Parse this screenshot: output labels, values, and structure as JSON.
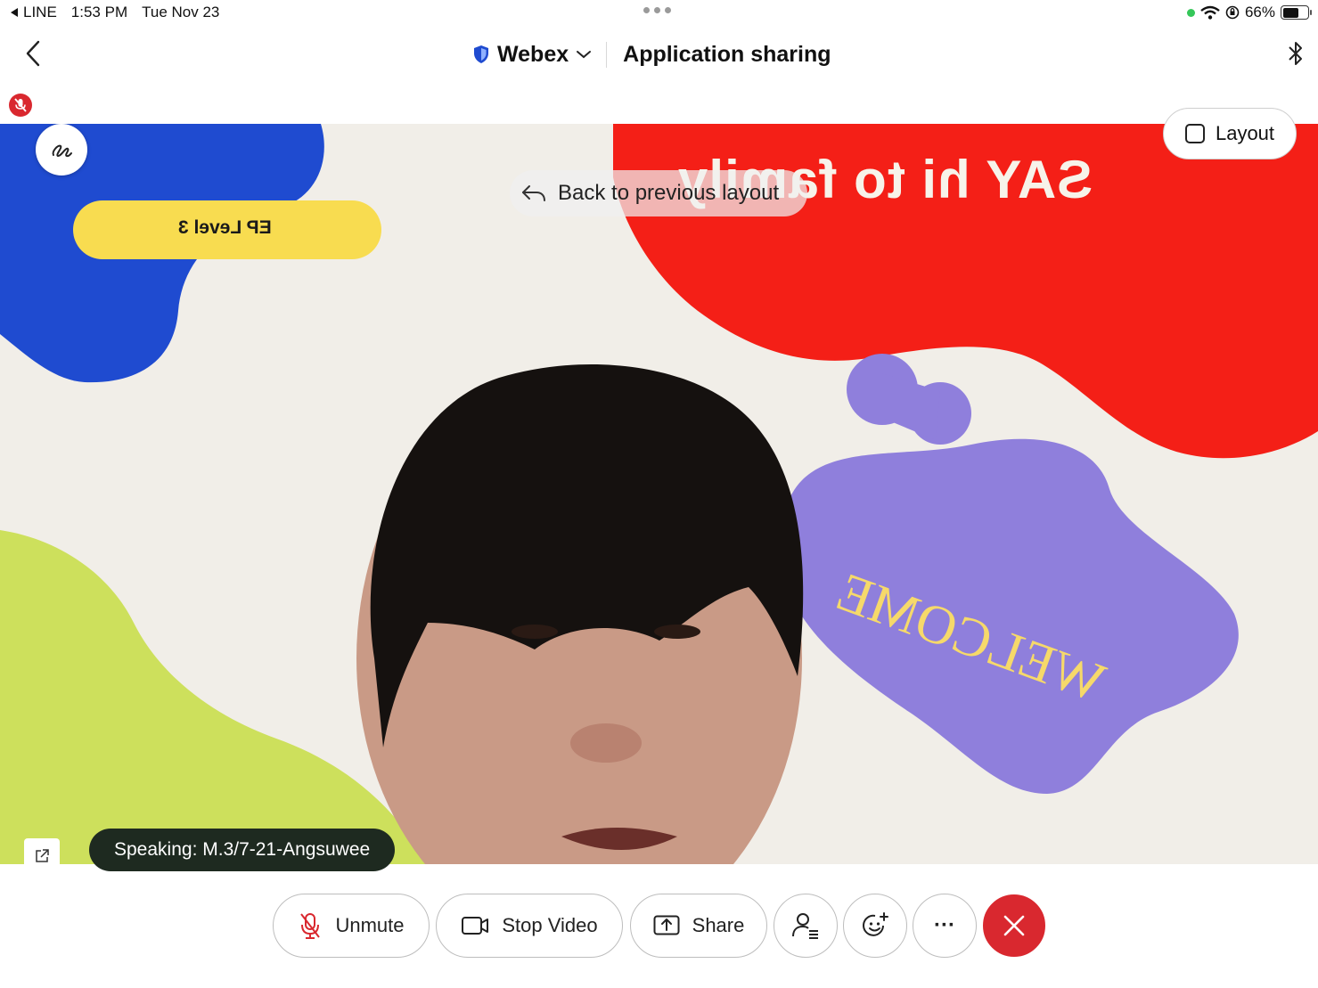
{
  "status_bar": {
    "back_app": "LINE",
    "time": "1:53 PM",
    "date": "Tue Nov 23",
    "battery": "66%"
  },
  "nav": {
    "app_name": "Webex",
    "title": "Application sharing"
  },
  "video": {
    "banner_text": "SAY hi to family",
    "level_text": "EP Level 3",
    "welcome_text": "WELCOME",
    "layout_label": "Layout",
    "back_layout_label": "Back to previous layout",
    "speaking": "Speaking: M.3/7-21-Angsuwee"
  },
  "controls": {
    "unmute_label": "Unmute",
    "stop_video_label": "Stop Video",
    "share_label": "Share",
    "more_label": "···"
  },
  "colors": {
    "end_call": "#d9282f",
    "accent_blue": "#1f4bd0",
    "banner_red": "#f41f17",
    "level_yellow": "#f8dc50",
    "welcome_purple": "#8f7fdc",
    "lime": "#cde05c"
  }
}
